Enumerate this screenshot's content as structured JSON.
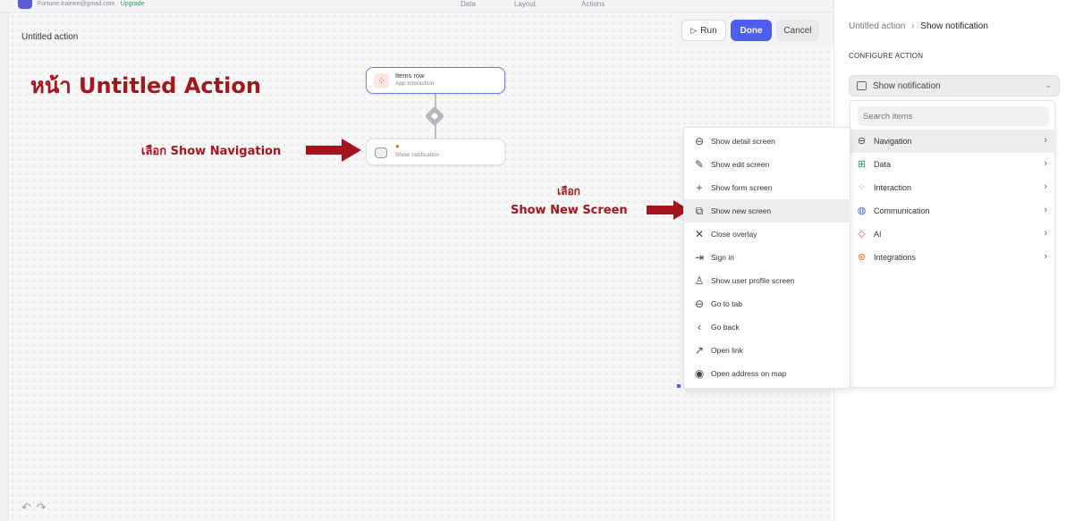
{
  "header": {
    "email": "Fortune.trainee@gmail.com",
    "upgrade": "Upgrade",
    "tabs": [
      "Data",
      "Layout",
      "Actions"
    ]
  },
  "canvas": {
    "title": "Untitled action",
    "undo_icon": "undo-icon",
    "redo_icon": "redo-icon",
    "nodes": [
      {
        "title": "Items row",
        "subtitle": "App interaction",
        "icon": "interaction-icon"
      },
      {
        "title": "",
        "subtitle": "Show notification",
        "icon": "notification-icon"
      }
    ]
  },
  "annotations": {
    "page": "หน้า Untitled Action",
    "pick_nav": "เลือก Show Navigation",
    "pick_word": "เลือก",
    "pick_screen": "Show New Screen",
    "color": "#a5151b"
  },
  "toolbar": {
    "run": "Run",
    "done": "Done",
    "cancel": "Cancel"
  },
  "panel": {
    "crumb_root": "Untitled action",
    "crumb_sep": "›",
    "crumb_current": "Show notification",
    "section": "CONFIGURE ACTION",
    "select_value": "Show notification",
    "search_placeholder": "Search items",
    "categories": [
      {
        "label": "Navigation",
        "icon": "navigation-icon"
      },
      {
        "label": "Data",
        "icon": "data-icon"
      },
      {
        "label": "Interaction",
        "icon": "interaction-icon"
      },
      {
        "label": "Communication",
        "icon": "globe-icon"
      },
      {
        "label": "AI",
        "icon": "ai-icon"
      },
      {
        "label": "Integrations",
        "icon": "integrations-icon"
      }
    ]
  },
  "submenu": [
    {
      "label": "Show detail screen",
      "icon": "arrow-circle-icon"
    },
    {
      "label": "Show edit screen",
      "icon": "pencil-icon"
    },
    {
      "label": "Show form screen",
      "icon": "plus-icon"
    },
    {
      "label": "Show new screen",
      "icon": "new-screen-icon"
    },
    {
      "label": "Close overlay",
      "icon": "close-icon"
    },
    {
      "label": "Sign in",
      "icon": "sign-in-icon"
    },
    {
      "label": "Show user profile screen",
      "icon": "user-icon"
    },
    {
      "label": "Go to tab",
      "icon": "arrow-circle-icon"
    },
    {
      "label": "Go back",
      "icon": "chevron-left-icon"
    },
    {
      "label": "Open link",
      "icon": "external-link-icon"
    },
    {
      "label": "Open address on map",
      "icon": "map-pin-icon"
    }
  ]
}
